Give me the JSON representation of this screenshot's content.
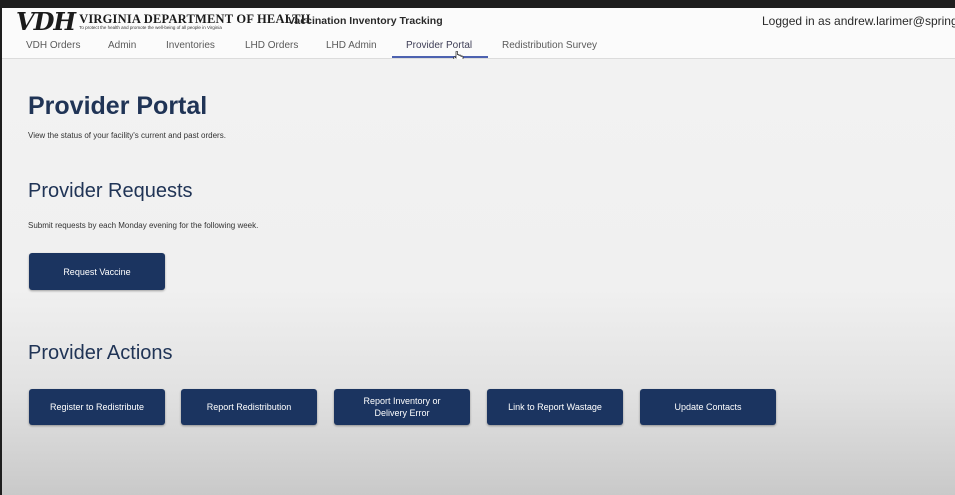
{
  "header": {
    "logo_mark": "VDH",
    "logo_name": "VIRGINIA DEPARTMENT OF HEALTH",
    "logo_tagline": "To protect the health and promote the well-being of all people in Virginia",
    "app_title": "Vaccination Inventory Tracking",
    "login_text": "Logged in as andrew.larimer@spring"
  },
  "nav": {
    "items": [
      {
        "label": "VDH Orders"
      },
      {
        "label": "Admin"
      },
      {
        "label": "Inventories"
      },
      {
        "label": "LHD Orders"
      },
      {
        "label": "LHD Admin"
      },
      {
        "label": "Provider Portal"
      },
      {
        "label": "Redistribution Survey"
      }
    ],
    "active": "Provider Portal"
  },
  "main": {
    "title": "Provider Portal",
    "description": "View the status of your facility's current and past orders.",
    "requests": {
      "title": "Provider Requests",
      "description": "Submit requests by each Monday evening for the following week.",
      "button": "Request Vaccine"
    },
    "actions": {
      "title": "Provider Actions",
      "buttons": [
        {
          "label": "Register to Redistribute"
        },
        {
          "label": "Report Redistribution"
        },
        {
          "label": "Report Inventory or Delivery Error"
        },
        {
          "label": "Link to Report Wastage"
        },
        {
          "label": "Update Contacts"
        }
      ]
    }
  },
  "colors": {
    "primary": "#1b3460",
    "heading": "#203456",
    "nav_underline": "#4d62b0"
  }
}
